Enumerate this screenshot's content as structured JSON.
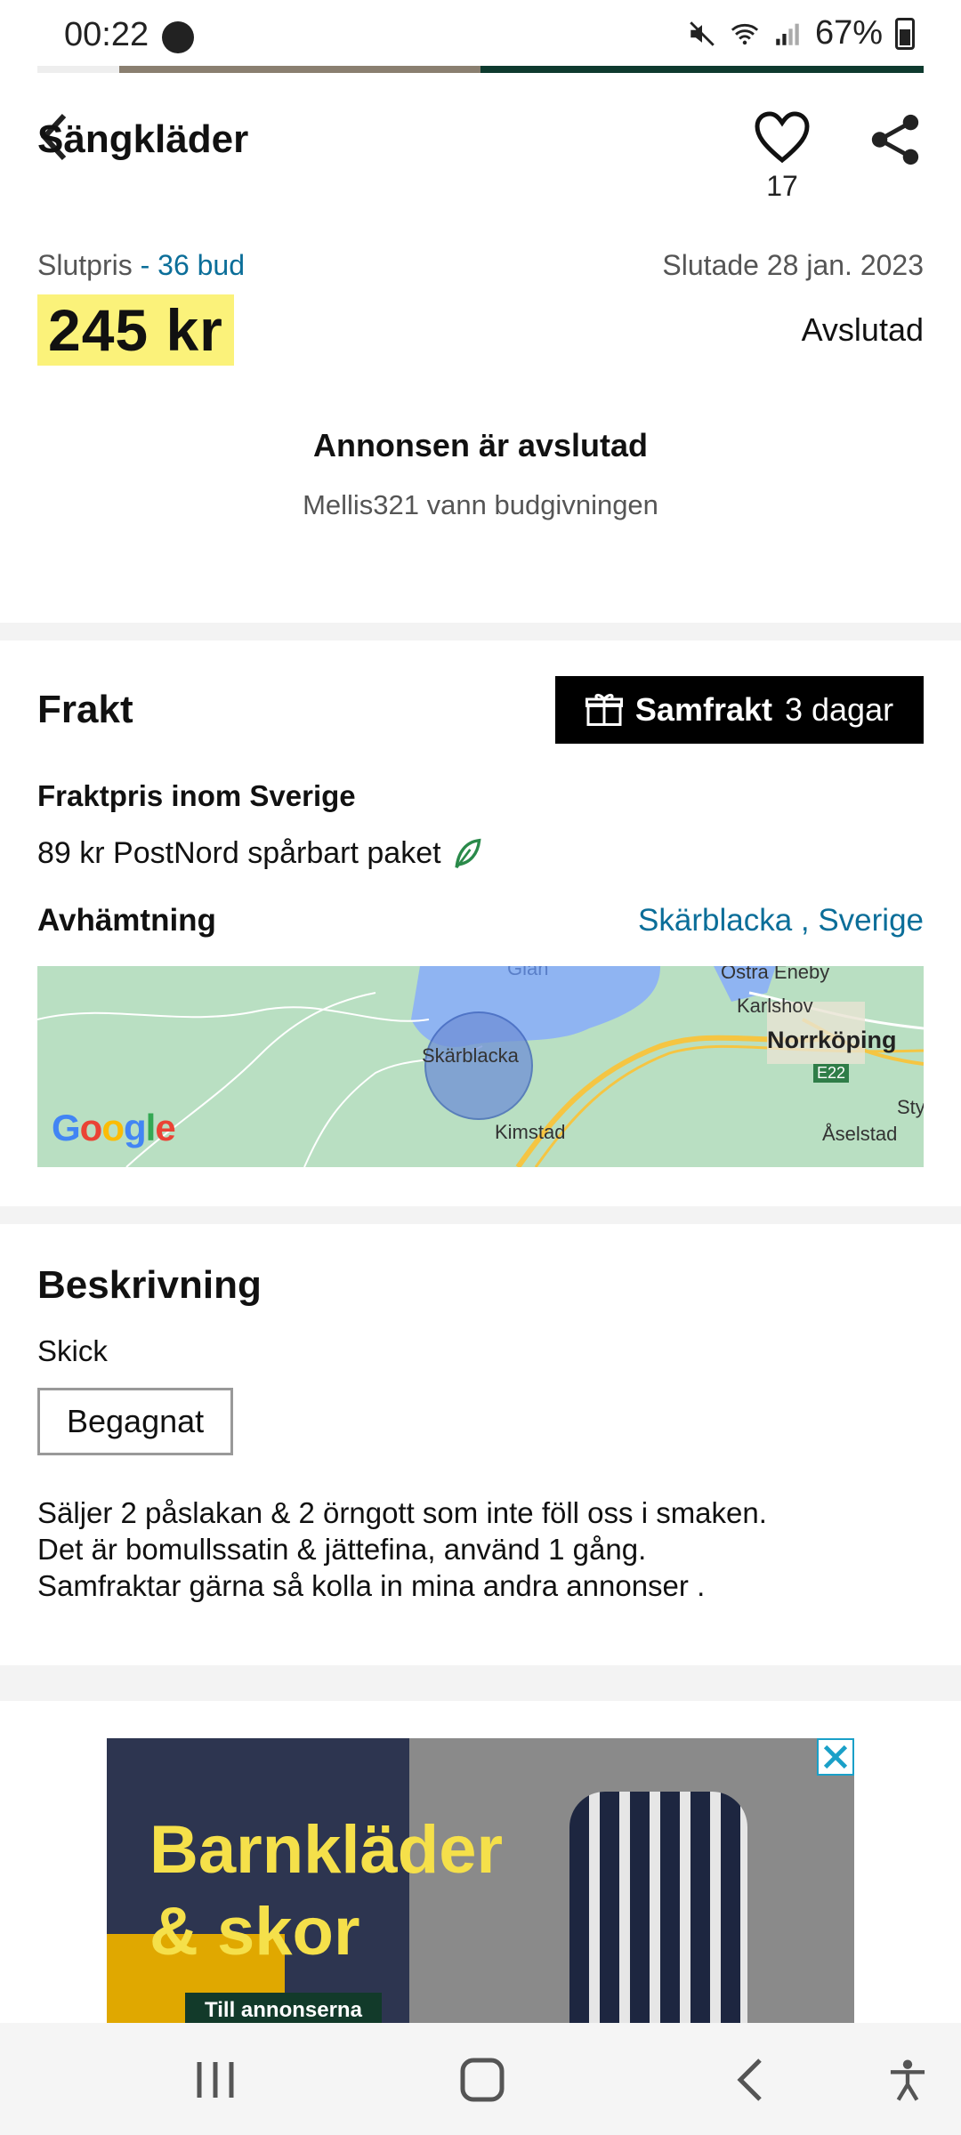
{
  "status_bar": {
    "time": "00:22",
    "battery": "67%",
    "icons": [
      "call-icon",
      "mute-icon",
      "wifi-icon",
      "signal-icon",
      "battery-icon"
    ]
  },
  "header": {
    "title": "Sängkläder",
    "favorites_count": "17"
  },
  "price_section": {
    "label": "Slutpris",
    "bids": "- 36 bud",
    "ended_date": "Slutade 28 jan. 2023",
    "price": "245 kr",
    "status": "Avslutad",
    "ended_title": "Annonsen är avslutad",
    "winner_text": "Mellis321 vann budgivningen"
  },
  "shipping": {
    "title": "Frakt",
    "samfrakt_label": "Samfrakt",
    "samfrakt_days": "3 dagar",
    "price_label": "Fraktpris inom Sverige",
    "shipping_option": "89 kr PostNord spårbart paket",
    "pickup_label": "Avhämtning",
    "pickup_location": "Skärblacka , Sverige"
  },
  "map": {
    "labels": {
      "skarblacka": "Skärblacka",
      "kimstad": "Kimstad",
      "norrkoping": "Norrköping",
      "karlshov": "Karlshov",
      "ostra_eneby": "Östra Eneby",
      "aselstad": "Åselstad",
      "e22": "E22",
      "sty": "Sty",
      "glan": "Glan"
    },
    "google_letters": [
      "G",
      "o",
      "o",
      "g",
      "l",
      "e"
    ]
  },
  "description": {
    "title": "Beskrivning",
    "condition_label": "Skick",
    "condition_value": "Begagnat",
    "lines": [
      "Säljer 2 påslakan & 2 örngott som inte föll oss i smaken.",
      "Det är bomullssatin & jättefina, använd 1 gång.",
      "Samfraktar gärna så kolla in mina andra annonser ."
    ]
  },
  "ad": {
    "headline_line1": "Barnkläder",
    "headline_line2": "& skor",
    "cta": "Till annonserna"
  },
  "colors": {
    "price_highlight": "#fbf27a",
    "link": "#0b6e99",
    "samfrakt_bg": "#000000",
    "leaf": "#2a8a4a"
  }
}
